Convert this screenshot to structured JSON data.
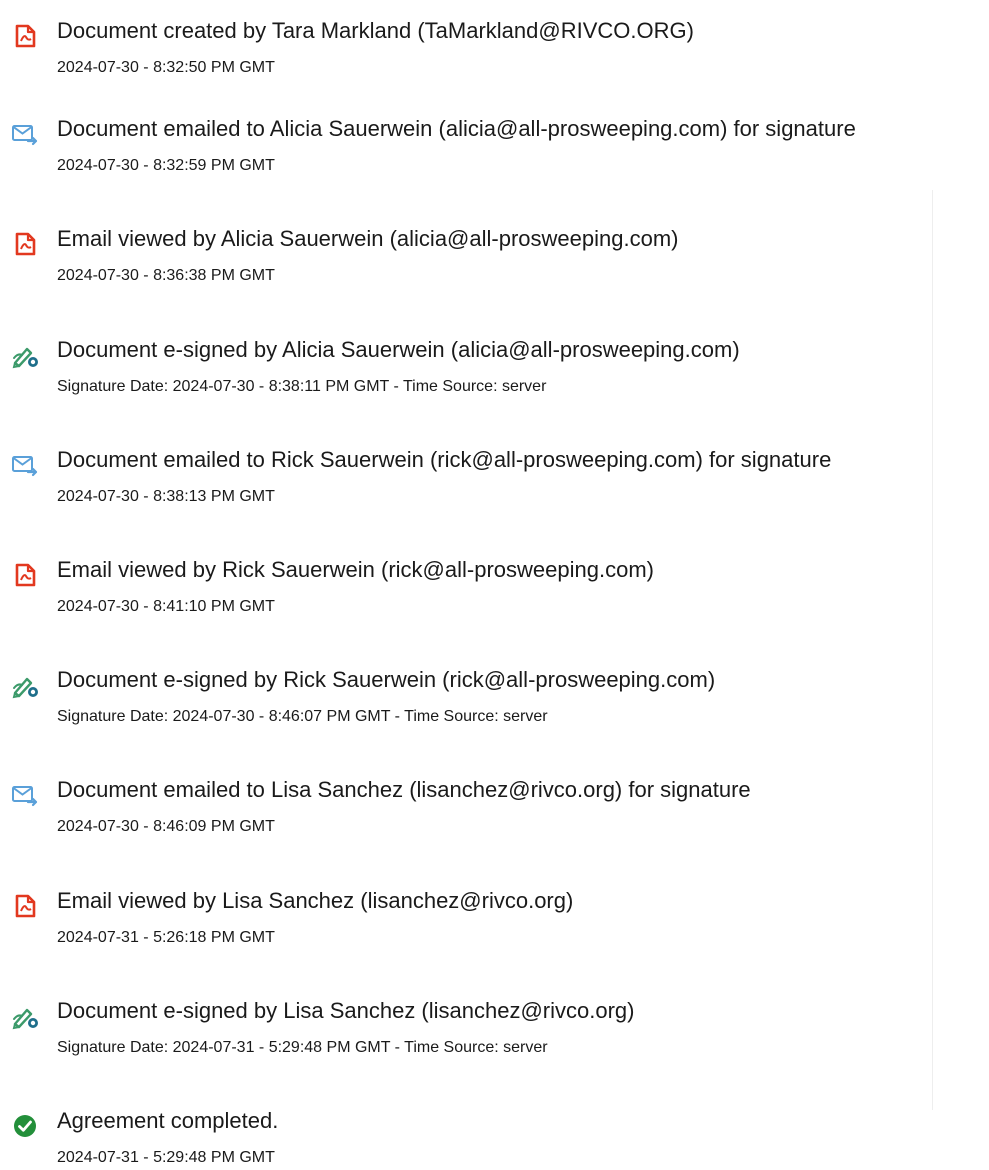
{
  "colors": {
    "pdf_red": "#e2381f",
    "email_blue": "#5aa0d9",
    "sign_green": "#3c9a6a",
    "complete_green": "#238f3a",
    "text": "#1a1a1a"
  },
  "entries": [
    {
      "icon": "pdf-document-icon",
      "title": "Document created by Tara Markland (TaMarkland@RIVCO.ORG)",
      "time": "2024-07-30 - 8:32:50 PM GMT"
    },
    {
      "icon": "email-send-icon",
      "title": "Document emailed to Alicia Sauerwein (alicia@all-prosweeping.com) for signature",
      "time": "2024-07-30 - 8:32:59 PM GMT"
    },
    {
      "icon": "pdf-document-icon",
      "title": "Email viewed by Alicia Sauerwein (alicia@all-prosweeping.com)",
      "time": "2024-07-30 - 8:36:38 PM GMT"
    },
    {
      "icon": "e-sign-icon",
      "title": "Document e-signed by Alicia Sauerwein (alicia@all-prosweeping.com)",
      "time": "Signature Date: 2024-07-30 - 8:38:11 PM GMT - Time Source: server"
    },
    {
      "icon": "email-send-icon",
      "title": "Document emailed to Rick Sauerwein (rick@all-prosweeping.com) for signature",
      "time": "2024-07-30 - 8:38:13 PM GMT"
    },
    {
      "icon": "pdf-document-icon",
      "title": "Email viewed by Rick Sauerwein (rick@all-prosweeping.com)",
      "time": "2024-07-30 - 8:41:10 PM GMT"
    },
    {
      "icon": "e-sign-icon",
      "title": "Document e-signed by Rick Sauerwein (rick@all-prosweeping.com)",
      "time": "Signature Date: 2024-07-30 - 8:46:07 PM GMT - Time Source: server"
    },
    {
      "icon": "email-send-icon",
      "title": "Document emailed to Lisa Sanchez (lisanchez@rivco.org) for signature",
      "time": "2024-07-30 - 8:46:09 PM GMT"
    },
    {
      "icon": "pdf-document-icon",
      "title": "Email viewed by Lisa Sanchez (lisanchez@rivco.org)",
      "time": "2024-07-31 - 5:26:18 PM GMT"
    },
    {
      "icon": "e-sign-icon",
      "title": "Document e-signed by Lisa Sanchez (lisanchez@rivco.org)",
      "time": "Signature Date: 2024-07-31 - 5:29:48 PM GMT - Time Source: server"
    },
    {
      "icon": "check-circle-icon",
      "title": "Agreement completed.",
      "time": "2024-07-31 - 5:29:48 PM GMT"
    }
  ]
}
